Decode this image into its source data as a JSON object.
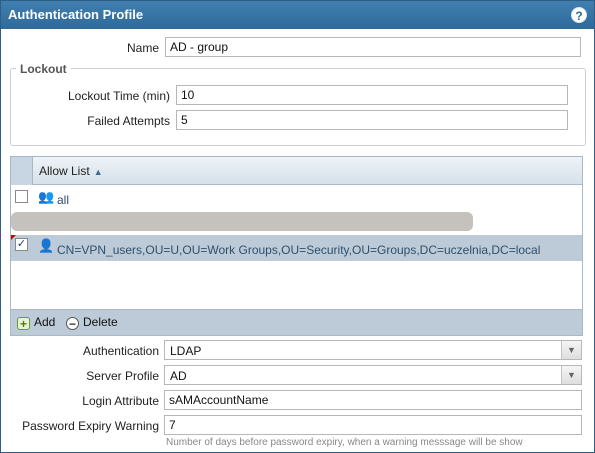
{
  "window": {
    "title": "Authentication Profile",
    "help_glyph": "?"
  },
  "form": {
    "name_label": "Name",
    "name_value": "AD - group"
  },
  "lockout": {
    "legend": "Lockout",
    "lockout_time_label": "Lockout Time (min)",
    "lockout_time_value": "10",
    "failed_attempts_label": "Failed Attempts",
    "failed_attempts_value": "5"
  },
  "allow_list": {
    "column_header": "Allow List",
    "sort_icon": "sort-ascending",
    "rows": [
      {
        "text": "all",
        "checked": false,
        "icon": "users-group-icon"
      },
      {
        "text": "CN=VPN_users,OU=U,OU=Work Groups,OU=Security,OU=Groups,DC=uczelnia,DC=local",
        "checked": true,
        "icon": "user-icon"
      }
    ],
    "add_label": "Add",
    "delete_label": "Delete"
  },
  "auth": {
    "authentication_label": "Authentication",
    "authentication_value": "LDAP",
    "server_profile_label": "Server Profile",
    "server_profile_value": "AD",
    "login_attribute_label": "Login Attribute",
    "login_attribute_value": "sAMAccountName",
    "password_expiry_label": "Password Expiry Warning",
    "password_expiry_value": "7",
    "password_expiry_hint": "Number of days before password expiry, when a warning messsage will be show"
  },
  "colors": {
    "titlebar": "#2f6a99",
    "selected_row": "#bccbd7",
    "toolbar": "#bccbd7"
  }
}
